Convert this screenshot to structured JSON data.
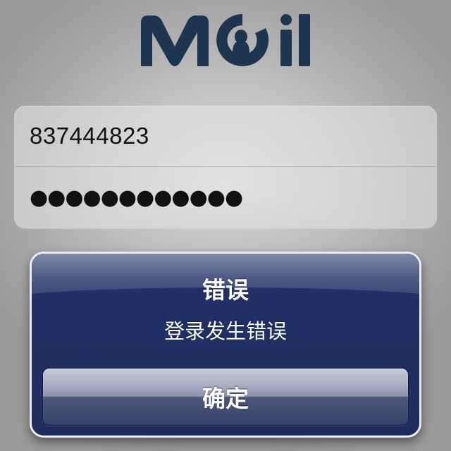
{
  "logo": {
    "wordmark": "Moil",
    "icon": "qq-penguin-icon",
    "color": "#1e3550"
  },
  "login": {
    "username_value": "837444823",
    "password_masked": "●●●●●●●●●●●●"
  },
  "alert": {
    "title": "错误",
    "message": "登录发生错误",
    "confirm_label": "确定",
    "background_color": "#213066"
  }
}
